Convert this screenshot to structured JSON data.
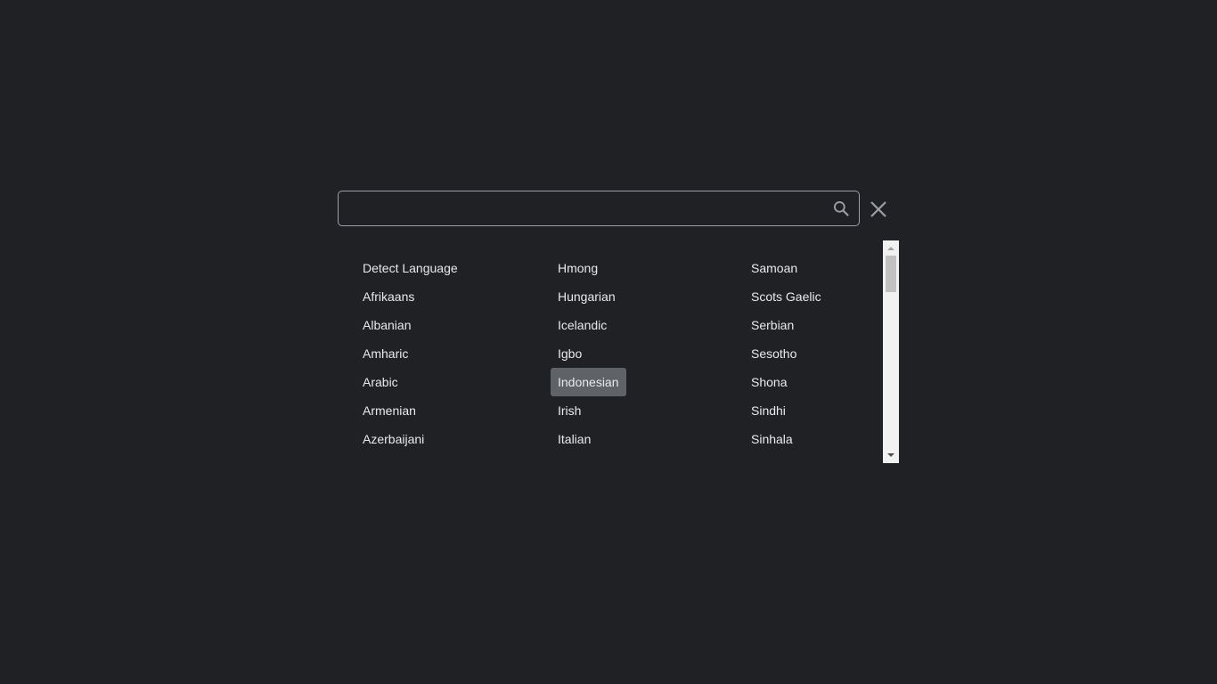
{
  "search": {
    "value": "",
    "placeholder": "",
    "search_icon": "search-icon",
    "close_icon": "close-icon"
  },
  "languages": {
    "columns": [
      [
        "Detect Language",
        "Afrikaans",
        "Albanian",
        "Amharic",
        "Arabic",
        "Armenian",
        "Azerbaijani"
      ],
      [
        "Hmong",
        "Hungarian",
        "Icelandic",
        "Igbo",
        "Indonesian",
        "Irish",
        "Italian"
      ],
      [
        "Samoan",
        "Scots Gaelic",
        "Serbian",
        "Sesotho",
        "Shona",
        "Sindhi",
        "Sinhala"
      ]
    ],
    "selected": "Indonesian"
  },
  "colors": {
    "background": "#202124",
    "text": "#e8eaed",
    "selected_bg": "#5f6368",
    "border": "#9aa0a6"
  }
}
